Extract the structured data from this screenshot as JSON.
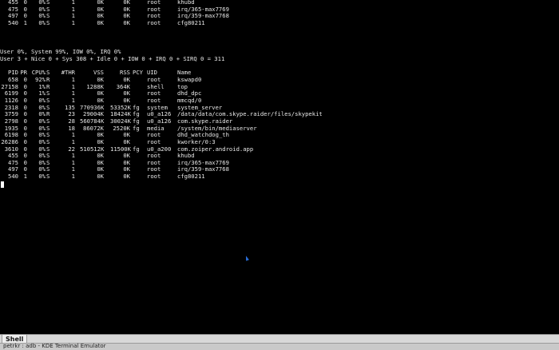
{
  "window": {
    "title": "petrkr : adb - KDE Terminal Emulator",
    "tab_label": "Shell"
  },
  "summary": {
    "cpu_line": "User 0%, System 99%, IOW 0%, IRQ 0%",
    "ticks_line": "User 3 + Nice 0 + Sys 308 + Idle 0 + IOW 0 + IRQ 0 + SIRQ 0 = 311"
  },
  "columns": [
    "PID",
    "PR",
    "CPU%",
    "S",
    "#THR",
    "VSS",
    "RSS",
    "PCY",
    "UID",
    "Name"
  ],
  "top_rows": [
    [
      "455",
      "0",
      "0%",
      "S",
      "1",
      "0K",
      "0K",
      "",
      "root",
      "khubd"
    ],
    [
      "475",
      "0",
      "0%",
      "S",
      "1",
      "0K",
      "0K",
      "",
      "root",
      "irq/365-max7769"
    ],
    [
      "497",
      "0",
      "0%",
      "S",
      "1",
      "0K",
      "0K",
      "",
      "root",
      "irq/359-max7768"
    ],
    [
      "540",
      "1",
      "0%",
      "S",
      "1",
      "0K",
      "0K",
      "",
      "root",
      "cfg80211"
    ]
  ],
  "rows": [
    [
      "658",
      "0",
      "92%",
      "R",
      "1",
      "0K",
      "0K",
      "",
      "root",
      "kswapd0"
    ],
    [
      "27158",
      "0",
      "1%",
      "R",
      "1",
      "1288K",
      "364K",
      "",
      "shell",
      "top"
    ],
    [
      "6199",
      "0",
      "1%",
      "S",
      "1",
      "0K",
      "0K",
      "",
      "root",
      "dhd_dpc"
    ],
    [
      "1126",
      "0",
      "0%",
      "S",
      "1",
      "0K",
      "0K",
      "",
      "root",
      "mmcqd/0"
    ],
    [
      "2318",
      "0",
      "0%",
      "S",
      "135",
      "770936K",
      "53352K",
      "fg",
      "system",
      "system_server"
    ],
    [
      "3759",
      "0",
      "0%",
      "R",
      "23",
      "29004K",
      "18424K",
      "fg",
      "u0_a126",
      "/data/data/com.skype.raider/files/skypekit"
    ],
    [
      "2798",
      "0",
      "0%",
      "S",
      "28",
      "560784K",
      "30024K",
      "fg",
      "u0_a126",
      "com.skype.raider"
    ],
    [
      "1935",
      "0",
      "0%",
      "S",
      "18",
      "86072K",
      "2520K",
      "fg",
      "media",
      "/system/bin/mediaserver"
    ],
    [
      "6198",
      "0",
      "0%",
      "S",
      "1",
      "0K",
      "0K",
      "",
      "root",
      "dhd_watchdog_th"
    ],
    [
      "26286",
      "0",
      "0%",
      "S",
      "1",
      "0K",
      "0K",
      "",
      "root",
      "kworker/0:3"
    ],
    [
      "3610",
      "0",
      "0%",
      "S",
      "22",
      "510512K",
      "11500K",
      "fg",
      "u0_a200",
      "com.zoiper.android.app"
    ],
    [
      "455",
      "0",
      "0%",
      "S",
      "1",
      "0K",
      "0K",
      "",
      "root",
      "khubd"
    ],
    [
      "475",
      "0",
      "0%",
      "S",
      "1",
      "0K",
      "0K",
      "",
      "root",
      "irq/365-max7769"
    ],
    [
      "497",
      "0",
      "0%",
      "S",
      "1",
      "0K",
      "0K",
      "",
      "root",
      "irq/359-max7768"
    ],
    [
      "540",
      "1",
      "0%",
      "S",
      "1",
      "0K",
      "0K",
      "",
      "root",
      "cfg80211"
    ]
  ],
  "colors": {
    "terminal_bg": "#000000",
    "terminal_fg": "#e8e8e8",
    "cursor": "#ffffff",
    "mouse_pointer": "#2a6fdb"
  }
}
